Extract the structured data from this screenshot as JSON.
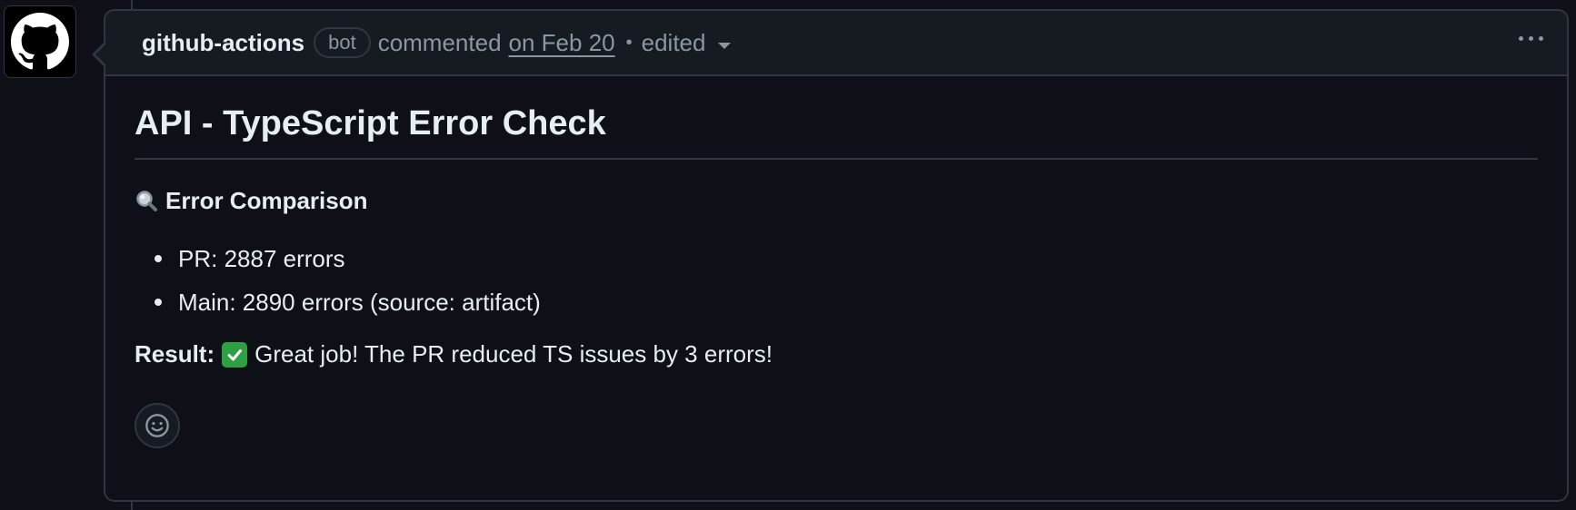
{
  "comment": {
    "author": "github-actions",
    "badge": "bot",
    "action": "commented",
    "date": "on Feb 20",
    "separator": "•",
    "edited": "edited",
    "title": "API - TypeScript Error Check",
    "section_heading": "Error Comparison",
    "bullets": [
      "PR: 2887 errors",
      "Main: 2890 errors (source: artifact)"
    ],
    "result_label": "Result:",
    "result_text": "Great job! The PR reduced TS issues by 3 errors!"
  },
  "icons": {
    "avatar": "github-logo-icon",
    "section": "magnifying-glass-icon",
    "result": "check-mark-icon",
    "menu": "kebab-icon",
    "reaction": "smiley-icon",
    "dropdown": "chevron-down-icon"
  },
  "colors": {
    "background": "#0d1117",
    "header_background": "#161b22",
    "border": "#30363d",
    "text": "#e6edf3",
    "muted": "#8d96a0",
    "success": "#2ea043"
  }
}
